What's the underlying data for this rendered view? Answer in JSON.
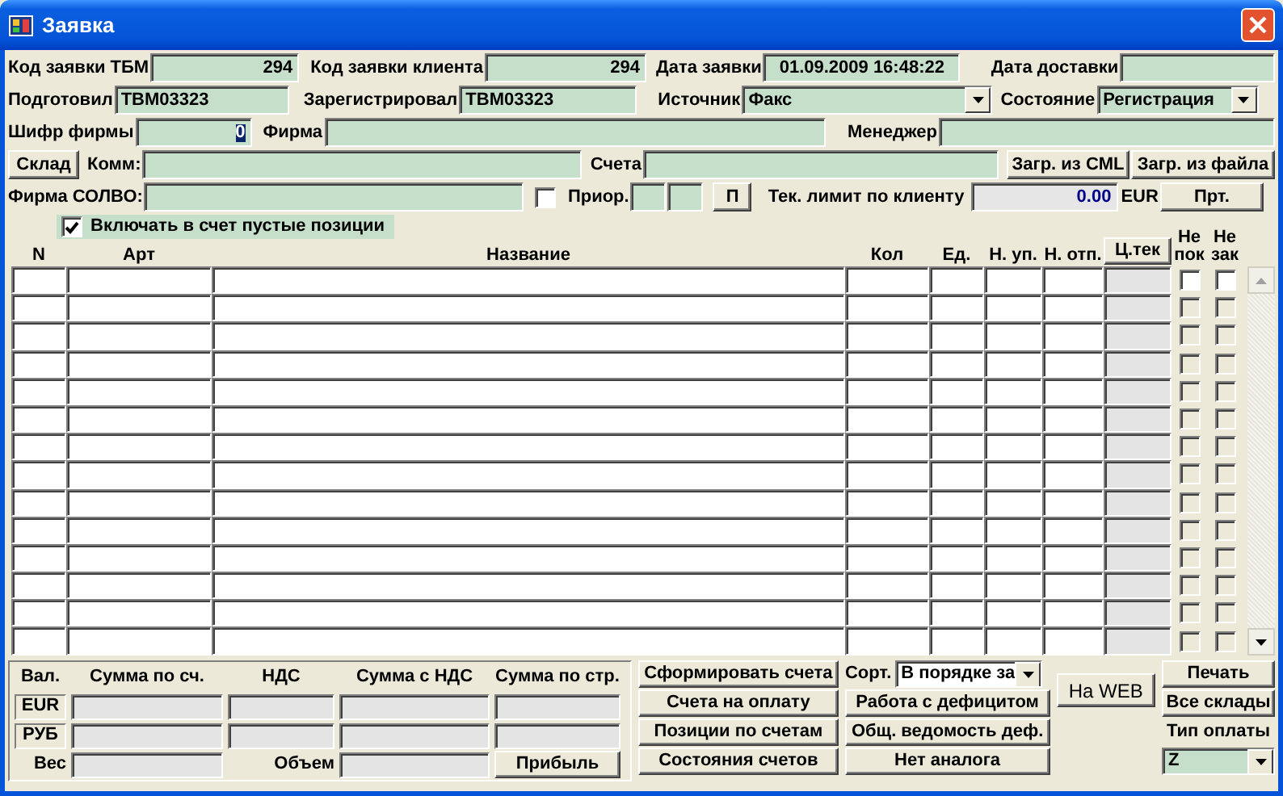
{
  "window": {
    "title": "Заявка"
  },
  "form_rows": [
    [
      {
        "kind": "label",
        "text": "Код заявки ТБМ"
      },
      {
        "kind": "field",
        "value": "294"
      },
      {
        "kind": "label",
        "text": "Код заявки клиента"
      },
      {
        "kind": "field",
        "value": "294"
      },
      {
        "kind": "label",
        "text": "Дата заявки"
      },
      {
        "kind": "field",
        "value": "01.09.2009 16:48:22"
      },
      {
        "kind": "label",
        "text": "Дата доставки"
      },
      {
        "kind": "field"
      }
    ],
    [
      {
        "kind": "label",
        "text": "Подготовил"
      },
      {
        "kind": "field",
        "value": "TBM03323"
      },
      {
        "kind": "label",
        "text": "Зарегистрировал"
      },
      {
        "kind": "field",
        "value": "TBM03323"
      },
      {
        "kind": "label",
        "text": "Источник"
      },
      {
        "kind": "select",
        "value": "Факс"
      },
      {
        "kind": "label",
        "text": "Состояние"
      },
      {
        "kind": "select",
        "value": "Регистрация"
      }
    ],
    [
      {
        "kind": "label",
        "text": "Шифр фирмы"
      },
      {
        "kind": "field",
        "value": "0",
        "text_selected": true
      },
      {
        "kind": "label",
        "text": "Фирма"
      },
      {
        "kind": "field"
      },
      {
        "kind": "label",
        "text": "Менеджер"
      },
      {
        "kind": "field"
      }
    ],
    [
      {
        "kind": "button",
        "text": "Склад"
      },
      {
        "kind": "label",
        "text": "Комм:"
      },
      {
        "kind": "field"
      },
      {
        "kind": "label",
        "text": "Счета"
      },
      {
        "kind": "field"
      },
      {
        "kind": "button",
        "text": "Загр. из CML"
      },
      {
        "kind": "button",
        "text": "Загр. из файла"
      }
    ],
    [
      {
        "kind": "label",
        "text": "Фирма СОЛВО:"
      },
      {
        "kind": "field"
      },
      {
        "kind": "checkbox",
        "checked": false
      },
      {
        "kind": "label",
        "text": "Приор."
      },
      {
        "kind": "field"
      },
      {
        "kind": "field"
      },
      {
        "kind": "button",
        "text": "П"
      },
      {
        "kind": "label",
        "text": "Тек. лимит по клиенту"
      },
      {
        "kind": "readonly",
        "value": "0.00"
      },
      {
        "kind": "label",
        "text": "EUR"
      },
      {
        "kind": "button",
        "text": "Прт."
      }
    ],
    [
      {
        "kind": "checkbox",
        "checked": true,
        "text": "Включать в счет пустые позиции"
      }
    ]
  ],
  "grid": {
    "columns": [
      {
        "kind": "text",
        "label": "N"
      },
      {
        "kind": "text",
        "label": "Арт"
      },
      {
        "kind": "text",
        "label": "Название"
      },
      {
        "kind": "text",
        "label": "Кол"
      },
      {
        "kind": "text",
        "label": "Ед."
      },
      {
        "kind": "text",
        "label": "Н. уп."
      },
      {
        "kind": "text",
        "label": "Н. отп."
      },
      {
        "kind": "button",
        "label": "Ц.тек"
      },
      {
        "kind": "check",
        "label": "Не пок"
      },
      {
        "kind": "check",
        "label": "Не зак"
      }
    ],
    "rows": [
      {
        "disabled": false,
        "checks": [
          false,
          false
        ]
      },
      {
        "disabled": true,
        "checks": [
          false,
          false
        ]
      },
      {
        "disabled": true,
        "checks": [
          false,
          false
        ]
      },
      {
        "disabled": true,
        "checks": [
          false,
          false
        ]
      },
      {
        "disabled": true,
        "checks": [
          false,
          false
        ]
      },
      {
        "disabled": true,
        "checks": [
          false,
          false
        ]
      },
      {
        "disabled": true,
        "checks": [
          false,
          false
        ]
      },
      {
        "disabled": true,
        "checks": [
          false,
          false
        ]
      },
      {
        "disabled": true,
        "checks": [
          false,
          false
        ]
      },
      {
        "disabled": true,
        "checks": [
          false,
          false
        ]
      },
      {
        "disabled": true,
        "checks": [
          false,
          false
        ]
      },
      {
        "disabled": true,
        "checks": [
          false,
          false
        ]
      },
      {
        "disabled": true,
        "checks": [
          false,
          false
        ]
      },
      {
        "disabled": true,
        "checks": [
          false,
          false
        ]
      }
    ]
  },
  "totals": {
    "columns": [
      "Вал.",
      "Сумма по сч.",
      "НДС",
      "Сумма с НДС",
      "Сумма по стр."
    ],
    "currencies": [
      "EUR",
      "РУБ"
    ],
    "weight_label": "Вес",
    "volume_label": "Объем",
    "profit_button": "Прибыль"
  },
  "actions": {
    "column_1": [
      "Сформировать счета",
      "Счета на оплату",
      "Позиции по счетам",
      "Состояния счетов"
    ],
    "sort": {
      "label": "Сорт.",
      "value": "В порядке за"
    },
    "column_2": [
      "Работа с дефицитом",
      "Общ. ведомость деф.",
      "Нет аналога"
    ],
    "web_button": "На WEB",
    "print_button": "Печать",
    "all_stores_button": "Все склады",
    "payment_type": {
      "label": "Тип оплаты",
      "value": "Z"
    }
  }
}
